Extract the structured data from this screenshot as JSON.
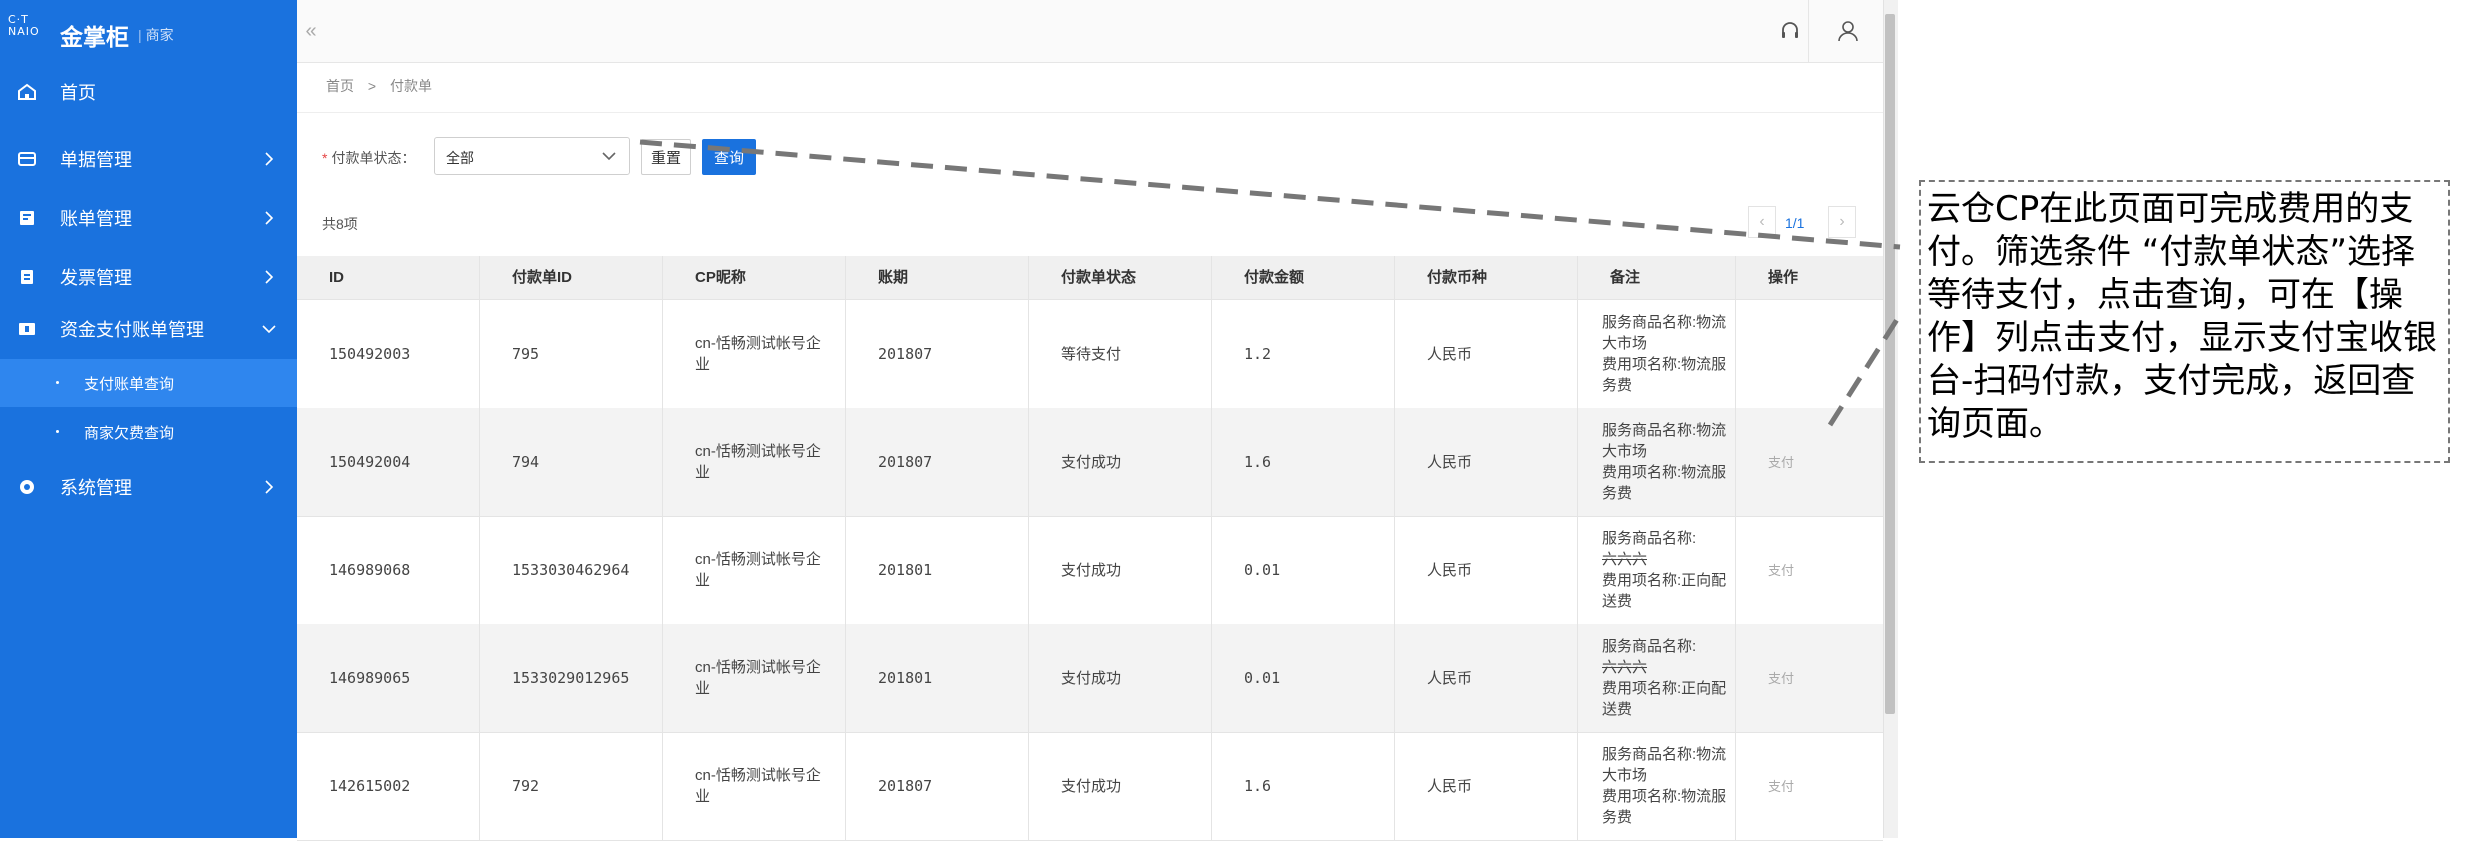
{
  "app": {
    "logo_mark": "C·T\nNAIO",
    "name": "金掌柜",
    "sub": "商家"
  },
  "sidebar": {
    "items": [
      {
        "label": "首页",
        "icon": "home-icon"
      },
      {
        "label": "单据管理",
        "icon": "document-icon"
      },
      {
        "label": "账单管理",
        "icon": "bill-icon"
      },
      {
        "label": "发票管理",
        "icon": "invoice-icon"
      },
      {
        "label": "资金支付账单管理",
        "icon": "fund-icon",
        "expanded": true
      },
      {
        "label": "系统管理",
        "icon": "settings-icon"
      }
    ],
    "subitems": [
      {
        "label": "支付账单查询",
        "active": true
      },
      {
        "label": "商家欠费查询",
        "active": false
      }
    ]
  },
  "topbar": {
    "collapse": "«",
    "icons": [
      "headset-icon",
      "user-icon"
    ]
  },
  "breadcrumb": {
    "home": "首页",
    "sep": ">",
    "current": "付款单"
  },
  "filter": {
    "label": "付款单状态：",
    "value": "全部",
    "reset": "重置",
    "query": "查询"
  },
  "list": {
    "count": "共8项",
    "page": "1/1",
    "prev": "‹",
    "next": "›"
  },
  "table": {
    "headers": [
      "ID",
      "付款单ID",
      "CP昵称",
      "账期",
      "付款单状态",
      "付款金额",
      "付款币种",
      "备注",
      "操作"
    ],
    "rows": [
      {
        "id": "150492003",
        "pay_id": "795",
        "cp": "cn-恬畅测试帐号企业",
        "period": "201807",
        "status": "等待支付",
        "amount": "1.2",
        "currency": "人民币",
        "note_service": "服务商品名称:物流大市场",
        "note_fee": "费用项名称:物流服务费",
        "action": ""
      },
      {
        "id": "150492004",
        "pay_id": "794",
        "cp": "cn-恬畅测试帐号企业",
        "period": "201807",
        "status": "支付成功",
        "amount": "1.6",
        "currency": "人民币",
        "note_service": "服务商品名称:物流大市场",
        "note_fee": "费用项名称:物流服务费",
        "action": "支付"
      },
      {
        "id": "146989068",
        "pay_id": "1533030462964",
        "cp": "cn-恬畅测试帐号企业",
        "period": "201801",
        "status": "支付成功",
        "amount": "0.01",
        "currency": "人民币",
        "note_service": "服务商品名称:",
        "note_service_strike": "六六六",
        "note_fee": "费用项名称:正向配送费",
        "action": "支付"
      },
      {
        "id": "146989065",
        "pay_id": "1533029012965",
        "cp": "cn-恬畅测试帐号企业",
        "period": "201801",
        "status": "支付成功",
        "amount": "0.01",
        "currency": "人民币",
        "note_service": "服务商品名称:",
        "note_service_strike": "六六六",
        "note_fee": "费用项名称:正向配送费",
        "action": "支付"
      },
      {
        "id": "142615002",
        "pay_id": "792",
        "cp": "cn-恬畅测试帐号企业",
        "period": "201807",
        "status": "支付成功",
        "amount": "1.6",
        "currency": "人民币",
        "note_service": "服务商品名称:物流大市场",
        "note_fee": "费用项名称:物流服务费",
        "action": "支付"
      }
    ]
  },
  "annotation": {
    "text": "云仓CP在此页面可完成费用的支付。筛选条件 “付款单状态”选择等待支付，点击查询，可在【操作】列点击支付，显示支付宝收银台-扫码付款，支付完成，返回查询页面。"
  },
  "colors": {
    "sidebar": "#1a72de",
    "accent": "#1a72de",
    "active_sub": "#2f86ee"
  }
}
